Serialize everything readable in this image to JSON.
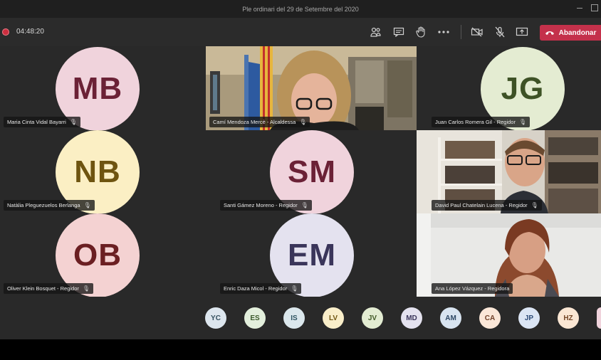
{
  "window": {
    "title": "Ple ordinari del 29 de Setembre del 2020"
  },
  "toolbar": {
    "timer": "04:48:20",
    "leave_label": "Abandonar",
    "icons": [
      "participants-icon",
      "chat-icon",
      "raise-hand-icon",
      "more-icon",
      "camera-off-icon",
      "mic-off-icon",
      "share-screen-icon",
      "phone-icon"
    ]
  },
  "tiles": [
    {
      "initials": "MB",
      "name": "Maria Cinta Vidal Bayarri",
      "avatar_bg": "#f0d3dc",
      "avatar_fg": "#6b2136",
      "video": false
    },
    {
      "initials": "",
      "name": "Camí Mendoza Mercè - Alcaldessa",
      "video": true
    },
    {
      "initials": "JG",
      "name": "Juan Carlos Romera Gil - Regidor",
      "avatar_bg": "#e4ecd2",
      "avatar_fg": "#3e5226",
      "video": false
    },
    {
      "initials": "NB",
      "name": "Natàlia Pleguezuelos Berlanga",
      "avatar_bg": "#fbefc4",
      "avatar_fg": "#6e5410",
      "video": false
    },
    {
      "initials": "SM",
      "name": "Santi Gámez Moreno - Regidor",
      "avatar_bg": "#f0d3dc",
      "avatar_fg": "#6b2136",
      "video": false
    },
    {
      "initials": "",
      "name": "David Paul Chatelain Lucena - Regidor",
      "video": true
    },
    {
      "initials": "OB",
      "name": "Oliver Klein Bosquet - Regidor",
      "avatar_bg": "#f4d2d2",
      "avatar_fg": "#6b1f22",
      "video": false
    },
    {
      "initials": "EM",
      "name": "Enric Daza Micol - Regidor",
      "avatar_bg": "#e4e2ef",
      "avatar_fg": "#3a355a",
      "video": false
    },
    {
      "initials": "",
      "name": "Ana López Vázquez - Regidora",
      "video": true
    }
  ],
  "participants": [
    {
      "initials": "YC",
      "bg": "#dde6ee",
      "fg": "#34505f"
    },
    {
      "initials": "ES",
      "bg": "#e3efdc",
      "fg": "#3d5a2c"
    },
    {
      "initials": "IS",
      "bg": "#dbe7ec",
      "fg": "#305563"
    },
    {
      "initials": "LV",
      "bg": "#f9eec9",
      "fg": "#705612"
    },
    {
      "initials": "JV",
      "bg": "#e3ecd2",
      "fg": "#435a28"
    },
    {
      "initials": "MD",
      "bg": "#e4e2ef",
      "fg": "#3b365c"
    },
    {
      "initials": "AM",
      "bg": "#d8e4f0",
      "fg": "#2d4764"
    },
    {
      "initials": "CA",
      "bg": "#fbe7d8",
      "fg": "#72422a"
    },
    {
      "initials": "JP",
      "bg": "#dbe5f4",
      "fg": "#2b4976"
    },
    {
      "initials": "HZ",
      "bg": "#fbe7d4",
      "fg": "#744626"
    }
  ]
}
